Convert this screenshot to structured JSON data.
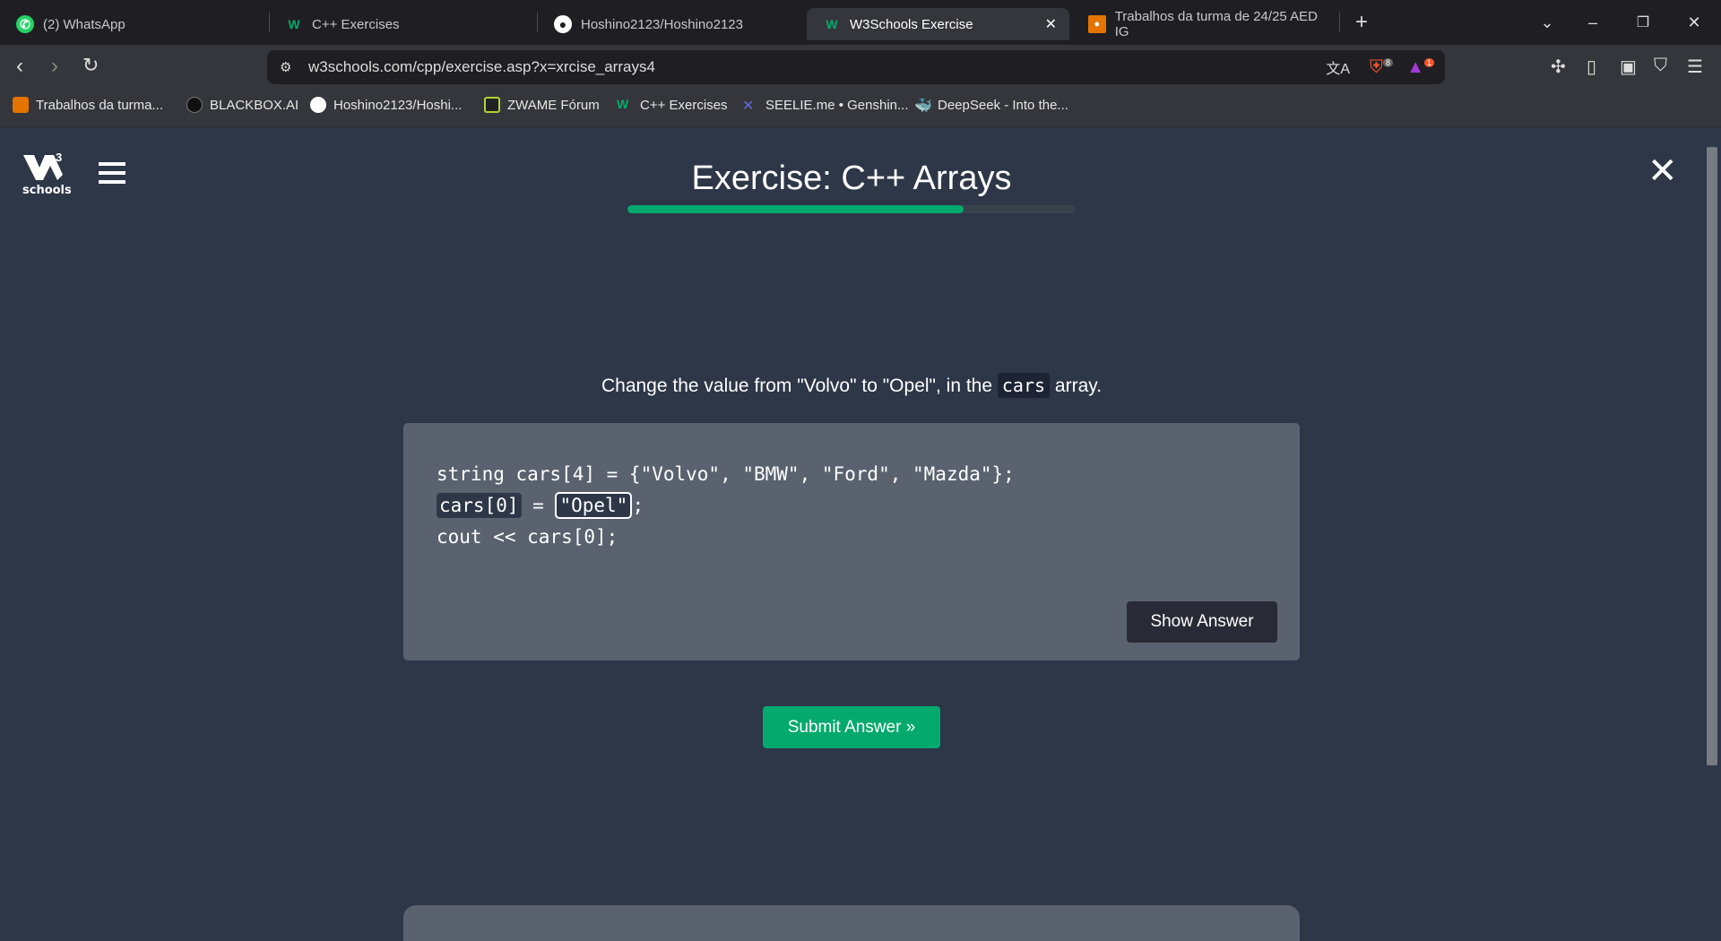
{
  "browser": {
    "tabs": [
      {
        "label": "(2) WhatsApp",
        "icon": "whatsapp-icon"
      },
      {
        "label": "C++ Exercises",
        "icon": "w3schools-icon"
      },
      {
        "label": "Hoshino2123/Hoshino2123",
        "icon": "github-icon"
      },
      {
        "label": "W3Schools Exercise",
        "icon": "w3schools-icon",
        "active": true
      },
      {
        "label": "Trabalhos da turma de 24/25 AED IG",
        "icon": "classroom-icon"
      }
    ],
    "url": "w3schools.com/cpp/exercise.asp?x=xrcise_arrays4",
    "brave_shield_count": "8",
    "rewards_count": "1",
    "bookmarks": [
      {
        "label": "Trabalhos da turma..."
      },
      {
        "label": "BLACKBOX.AI"
      },
      {
        "label": "Hoshino2123/Hoshi..."
      },
      {
        "label": "ZWAME Fórum"
      },
      {
        "label": "C++ Exercises"
      },
      {
        "label": "SEELIE.me • Genshin..."
      },
      {
        "label": "DeepSeek - Into the..."
      }
    ]
  },
  "page": {
    "logo_text": "schools",
    "logo_sup": "3",
    "title": "Exercise: C++ Arrays",
    "progress": 0.75,
    "instruction_pre": "Change the value from \"Volvo\" to \"Opel\", in the",
    "instruction_kw": "cars",
    "instruction_post": "array.",
    "code": {
      "line1": "string cars[4] = {\"Volvo\", \"BMW\", \"Ford\", \"Mazda\"};",
      "line2_prefix": "cars[0]",
      "line2_eq": " = ",
      "answer_value": "\"Opel\"",
      "line2_suffix": ";",
      "line3": "cout << cars[0];"
    },
    "show_answer_label": "Show Answer",
    "submit_label": "Submit Answer »"
  },
  "colors": {
    "accent": "#04aa6d",
    "background": "#2d3748",
    "codebox": "#5a6270"
  }
}
